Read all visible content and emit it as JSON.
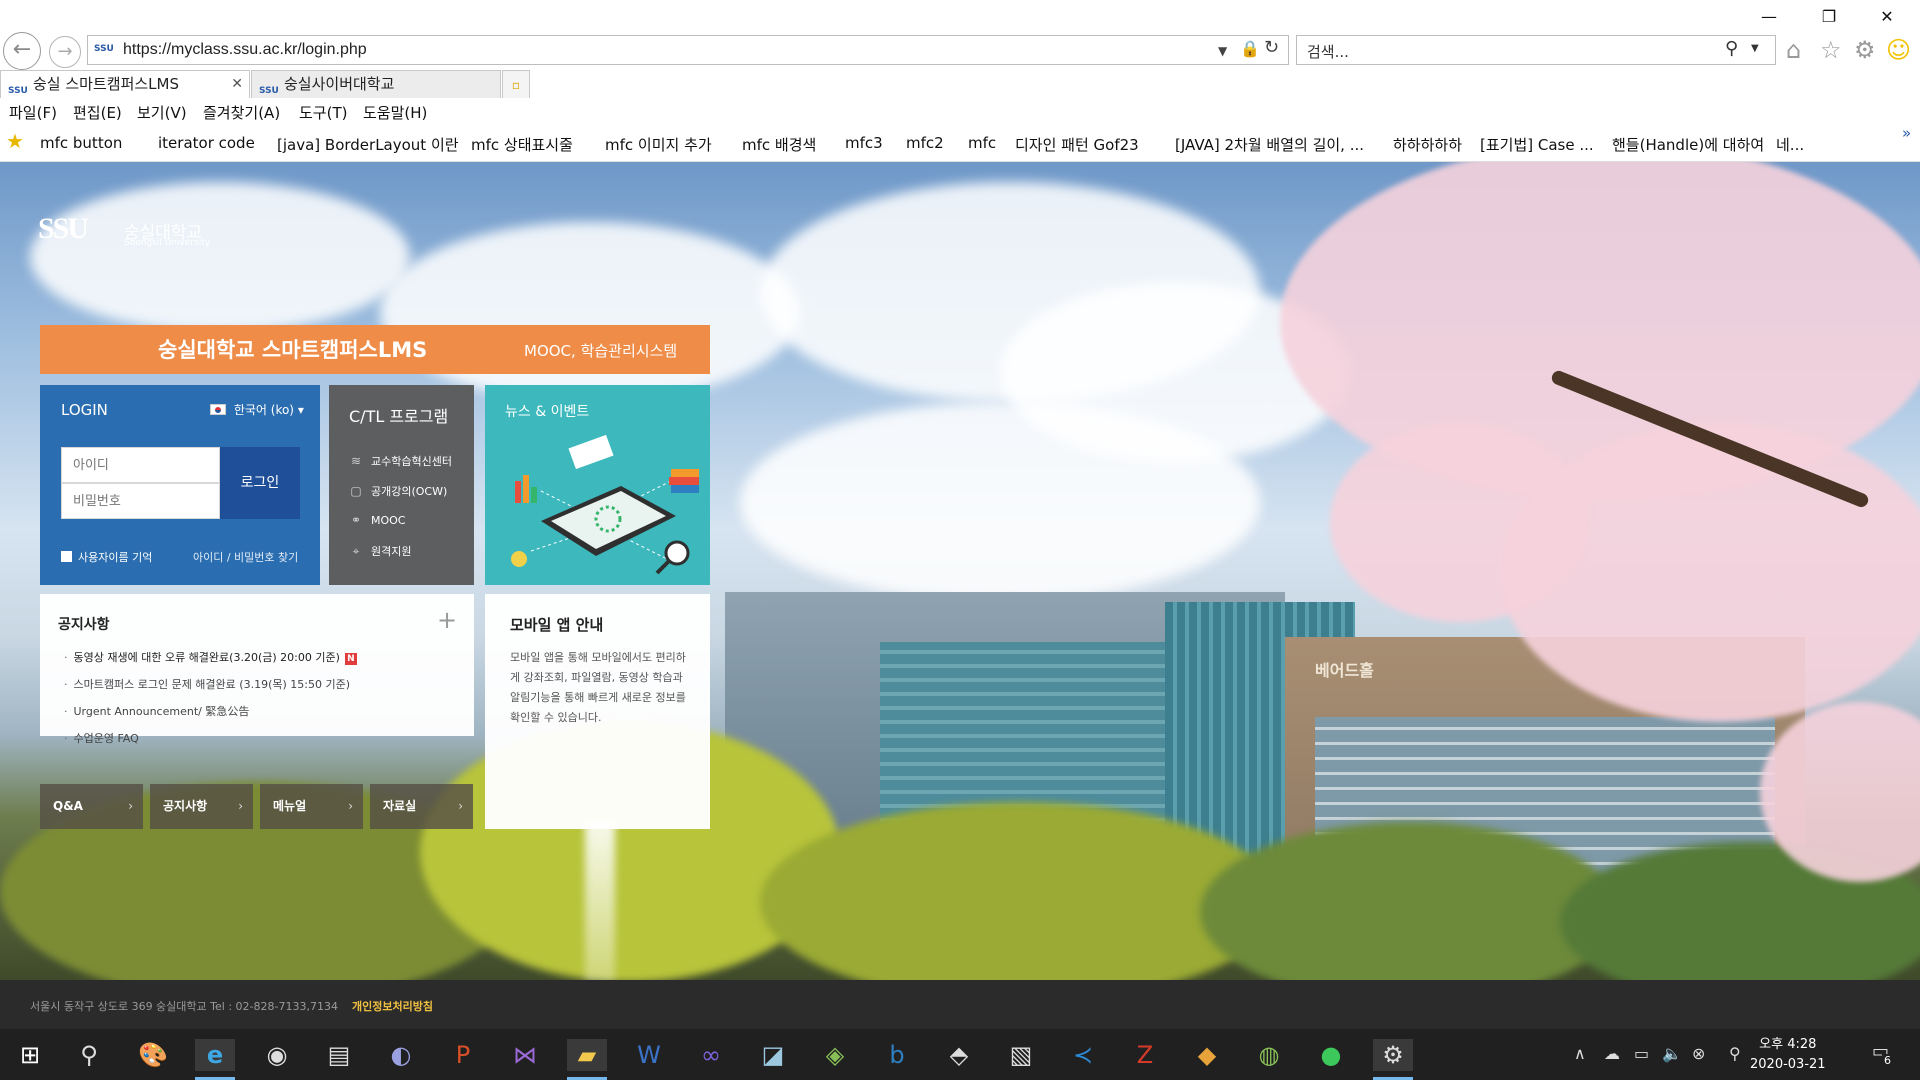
{
  "browser": {
    "url": "https://myclass.ssu.ac.kr/login.php",
    "search_placeholder": "검색...",
    "tabs": [
      {
        "label": "숭실 스마트캠퍼스LMS",
        "active": true
      },
      {
        "label": "숭실사이버대학교",
        "active": false
      }
    ],
    "menu": [
      "파일(F)",
      "편집(E)",
      "보기(V)",
      "즐겨찾기(A)",
      "도구(T)",
      "도움말(H)"
    ],
    "favorites": [
      "mfc button",
      "iterator code",
      "[java] BorderLayout 이란",
      "mfc 상태표시줄",
      "mfc 이미지 추가",
      "mfc 배경색",
      "mfc3",
      "mfc2",
      "mfc",
      "디자인 패턴 Gof23",
      "[JAVA] 2차월 배열의 길이, ...",
      "하하하하하",
      "[표기법] Case ...",
      "핸들(Handle)에 대하여",
      "네..."
    ]
  },
  "page": {
    "logo_text": "숭실대학교",
    "logo_sub": "Soongsil University",
    "header_title": "숭실대학교 스마트캠퍼스LMS",
    "header_subtitle": "MOOC, 학습관리시스템",
    "login": {
      "title": "LOGIN",
      "language": "한국어 (ko)",
      "id_placeholder": "아이디",
      "pw_placeholder": "비밀번호",
      "button": "로그인",
      "remember": "사용자이름 기억",
      "find": "아이디 / 비밀번호 찾기"
    },
    "ctl": {
      "title": "C/TL 프로그램",
      "items": [
        "교수학습혁신센터",
        "공개강의(OCW)",
        "MOOC",
        "원격지원"
      ]
    },
    "news": {
      "title": "뉴스 & 이벤트"
    },
    "notice": {
      "title": "공지사항",
      "items": [
        "동영상 재생에 대한 오류 해결완료(3.20(금) 20:00 기준)",
        "스마트캠퍼스 로그인 문제 해결완료 (3.19(목) 15:50 기준)",
        "Urgent Announcement/ 緊急公告",
        "수업운영 FAQ"
      ],
      "new_badge": "N"
    },
    "quick_links": [
      "Q&A",
      "공지사항",
      "메뉴얼",
      "자료실"
    ],
    "mobile": {
      "title": "모바일 앱 안내",
      "desc": "모바일 앱을 통해 모바일에서도 편리하게 강좌조회, 파일열람, 동영상 학습과 알림기능을 통해 빠르게 새로운 정보를 확인할 수 있습니다."
    },
    "building_sign": "베어드홀",
    "footer_address": "서울시 동작구 상도로 369 숭실대학교    Tel : 02-828-7133,7134",
    "footer_privacy": "개인정보처리방침"
  },
  "taskbar": {
    "time": "오후 4:28",
    "date": "2020-03-21",
    "notification_count": "6"
  },
  "colors": {
    "lms_orange": "#ee8c48",
    "login_blue": "#2a6db0",
    "ctl_gray": "#5d5e60",
    "news_teal": "#3db8bd"
  }
}
